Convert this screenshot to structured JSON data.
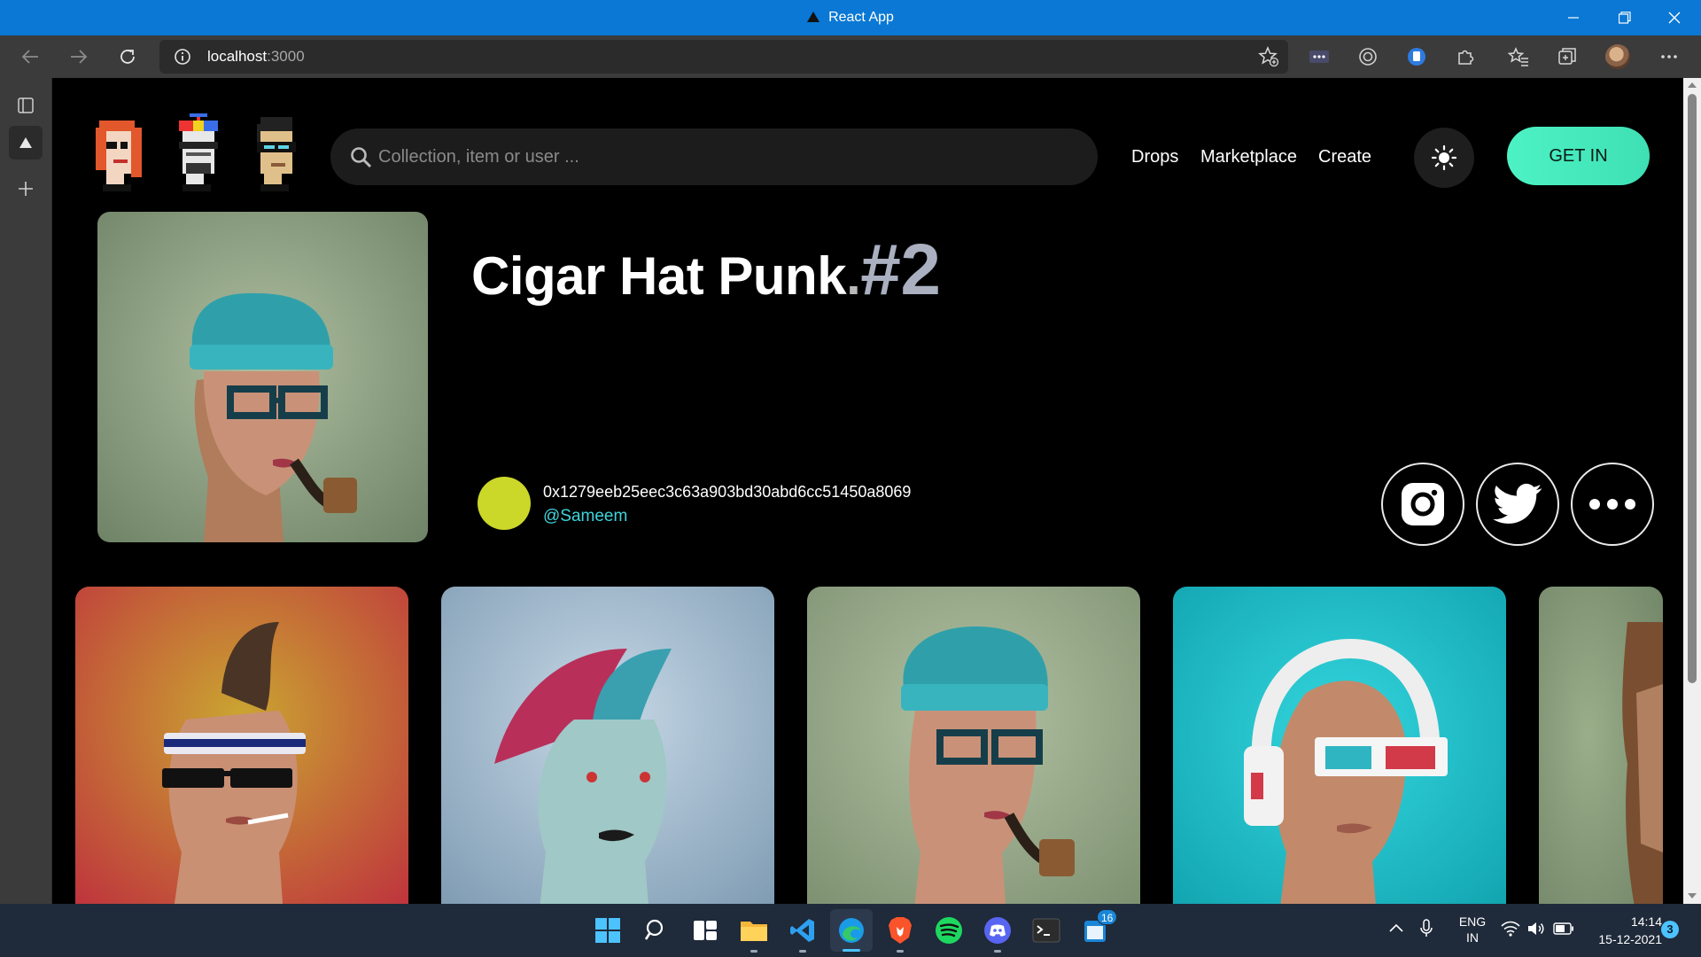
{
  "window": {
    "title": "React App"
  },
  "browser": {
    "url_host": "localhost",
    "url_port": ":3000"
  },
  "header": {
    "search_placeholder": "Collection, item or user ...",
    "nav": [
      "Drops",
      "Marketplace",
      "Create"
    ],
    "cta": "GET IN"
  },
  "hero": {
    "title": "Cigar Hat Punk",
    "title_dot": ".",
    "number": "#2",
    "owner_address": "0x1279eeb25eec3c63a903bd30abd6cc51450a8069",
    "owner_handle": "@Sameem"
  },
  "taskbar": {
    "lang": "ENG",
    "region": "IN",
    "time": "14:14",
    "date": "15-12-2021",
    "notification_count": "3",
    "badge_count": "16"
  },
  "colors": {
    "titlebar": "#0a78d4",
    "accent": "#4df2c4",
    "owner_dot": "#cbd729",
    "handle": "#3fd4dc"
  },
  "card_backgrounds": [
    "#c93344",
    "#90adc2",
    "#96a886",
    "#1ab9c4",
    "#7e9374"
  ]
}
